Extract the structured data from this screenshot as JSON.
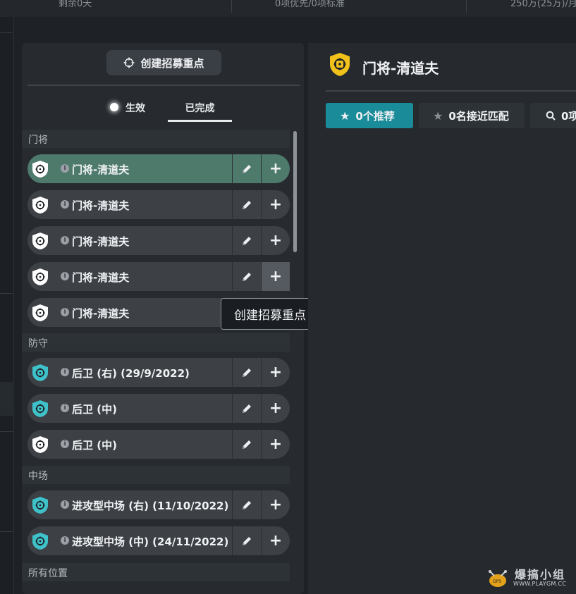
{
  "top_strip": {
    "cells": [
      "剩余0天",
      "0项优先/0项标准",
      "250万(25万)/月"
    ]
  },
  "left_panel": {
    "create_button_label": "创建招募重点",
    "tabs": [
      {
        "label": "生效",
        "active": true
      },
      {
        "label": "已完成",
        "active": false
      }
    ],
    "sections": [
      {
        "title": "门将",
        "items": [
          {
            "label": "门将-清道夫",
            "icon": "shield-white-icon",
            "selected": true
          },
          {
            "label": "门将-清道夫",
            "icon": "shield-white-icon",
            "selected": false
          },
          {
            "label": "门将-清道夫",
            "icon": "shield-white-icon",
            "selected": false
          },
          {
            "label": "门将-清道夫",
            "icon": "shield-white-icon",
            "selected": false
          },
          {
            "label": "门将-清道夫",
            "icon": "shield-white-icon",
            "selected": false
          }
        ]
      },
      {
        "title": "防守",
        "items": [
          {
            "label": "后卫 (右) (29/9/2022)",
            "icon": "shield-cyan-icon"
          },
          {
            "label": "后卫 (中)",
            "icon": "shield-cyan-icon"
          },
          {
            "label": "后卫 (中)",
            "icon": "shield-white-icon"
          }
        ]
      },
      {
        "title": "中场",
        "items": [
          {
            "label": "进攻型中场 (右) (11/10/2022)",
            "icon": "shield-cyan-icon"
          },
          {
            "label": "进攻型中场 (中) (24/11/2022)",
            "icon": "shield-cyan-icon"
          }
        ]
      },
      {
        "title": "所有位置",
        "items": []
      }
    ],
    "tooltip": "创建招募重点"
  },
  "right_panel": {
    "title": "门将-清道夫",
    "filters": [
      {
        "label": "0个推荐",
        "icon": "star-icon",
        "active": true
      },
      {
        "label": "0名接近匹配",
        "icon": "star-icon",
        "active": false
      },
      {
        "label": "0项",
        "icon": "search-icon",
        "active": false
      }
    ]
  },
  "watermark": {
    "cn": "爆搞小组",
    "url": "WWW.PLAYGM.CC"
  },
  "colors": {
    "accent_teal": "#1a8b99",
    "selected_row": "#4e7a6c",
    "shield_yellow": "#f2c21b",
    "shield_cyan": "#3fc1c9"
  }
}
